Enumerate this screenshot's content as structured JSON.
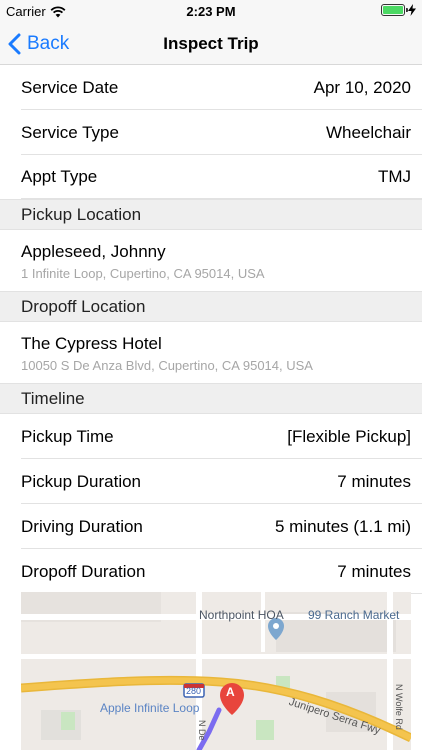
{
  "status_bar": {
    "carrier": "Carrier",
    "time": "2:23 PM",
    "icons": [
      "wifi-icon",
      "battery-icon",
      "charging-bolt-icon"
    ],
    "battery_level": 1.0,
    "battery_color": "#4cd964"
  },
  "nav": {
    "back_label": "Back",
    "title": "Inspect Trip",
    "accent_color": "#1a7bff"
  },
  "details": [
    {
      "label": "Service Date",
      "value": "Apr 10, 2020"
    },
    {
      "label": "Service Type",
      "value": "Wheelchair"
    },
    {
      "label": "Appt Type",
      "value": "TMJ"
    }
  ],
  "pickup": {
    "header": "Pickup Location",
    "name": "Appleseed, Johnny",
    "address": "1 Infinite Loop, Cupertino, CA 95014, USA"
  },
  "dropoff": {
    "header": "Dropoff Location",
    "name": "The Cypress Hotel",
    "address": "10050 S De Anza Blvd, Cupertino, CA 95014, USA"
  },
  "timeline": {
    "header": "Timeline",
    "rows": [
      {
        "label": "Pickup Time",
        "value": "[Flexible Pickup]"
      },
      {
        "label": "Pickup Duration",
        "value": "7 minutes"
      },
      {
        "label": "Driving Duration",
        "value": "5 minutes (1.1 mi)"
      },
      {
        "label": "Dropoff Duration",
        "value": "7 minutes"
      }
    ]
  },
  "map": {
    "labels": {
      "northpoint": "Northpoint HOA",
      "ranch": "99 Ranch Market",
      "apple": "Apple Infinite Loop",
      "junipero": "Junipero Serra Fwy",
      "highway_shield": "280",
      "wolfe": "N Wolfe Rd",
      "de_anza": "N De",
      "pin_letter": "A"
    },
    "pin_color": "#e8453c",
    "route_color": "#7b6cf0",
    "freeway_color": "#f4c44e",
    "poi_color": "#7da7cf"
  }
}
